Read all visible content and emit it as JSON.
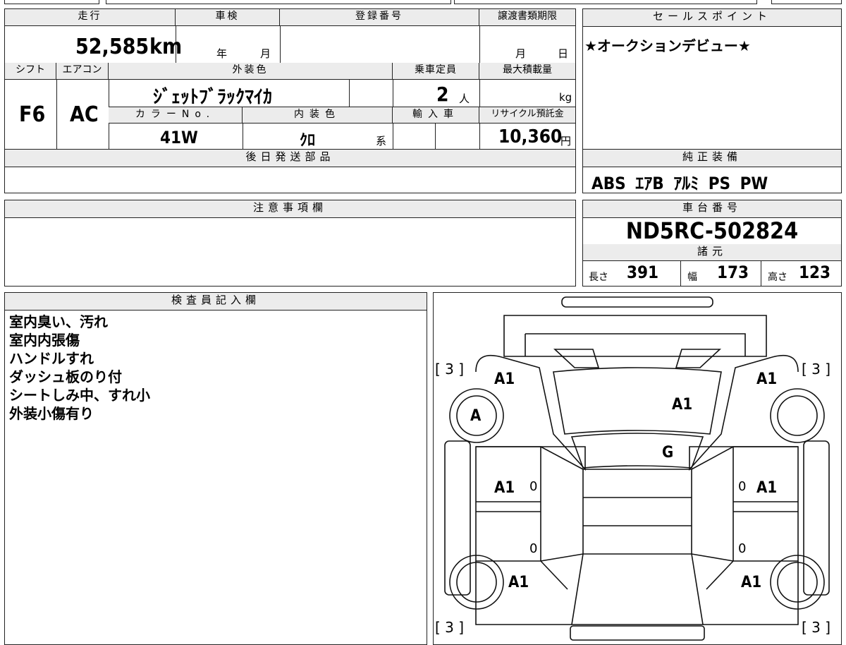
{
  "basic": {
    "mileage_label": "走行",
    "mileage_value": "52,585",
    "mileage_unit": "km",
    "inspection_label": "車検",
    "year_label": "年",
    "month_label": "月",
    "registration_label": "登録番号",
    "transfer_label": "譲渡書類期限",
    "transfer_month": "月",
    "transfer_day": "日",
    "shift_label": "シフト",
    "shift_value": "F6",
    "ac_label": "エアコン",
    "ac_value": "AC",
    "exterior_label": "外装色",
    "exterior_value": "ｼﾞｪｯﾄﾌﾞﾗｯｸﾏｲｶ",
    "capacity_label": "乗車定員",
    "capacity_value": "2",
    "capacity_unit": "人",
    "load_label": "最大積載量",
    "load_unit": "kg",
    "color_no_label": "カラーNo.",
    "color_no_value": "41W",
    "interior_label": "内装色",
    "interior_value": "ｸﾛ",
    "interior_suffix": "系",
    "import_label": "輸入車",
    "recycle_label": "リサイクル預託金",
    "recycle_value": "10,360",
    "recycle_unit": "円"
  },
  "later_parts": {
    "label": "後日発送部品"
  },
  "notes": {
    "label": "注意事項欄"
  },
  "sales_point": {
    "label": "セールスポイント",
    "text": "★オークションデビュー★"
  },
  "equipment": {
    "label": "純正装備",
    "text": "ABS ｴｱB ｱﾙﾐ PS PW"
  },
  "chassis": {
    "label": "車台番号",
    "value": "ND5RC-502824"
  },
  "specs": {
    "label": "諸元",
    "length_label": "長さ",
    "length_value": "391",
    "width_label": "幅",
    "width_value": "173",
    "height_label": "高さ",
    "height_value": "123"
  },
  "inspector": {
    "label": "検査員記入欄",
    "lines": [
      "室内臭い、汚れ",
      "室内内張傷",
      "ハンドルすれ",
      "ダッシュ板のり付",
      "シートしみ中、すれ小",
      "外装小傷有り"
    ]
  },
  "diagram": {
    "tire_count_label": "[ 3 ]",
    "marks": {
      "front_left": "A1",
      "front_right": "A1",
      "hood": "A1",
      "wheel_front_left": "A",
      "windshield": "G",
      "door_left": "A1",
      "door_right": "A1",
      "rear_left": "A1",
      "rear_right": "A1",
      "zero": "0"
    }
  }
}
